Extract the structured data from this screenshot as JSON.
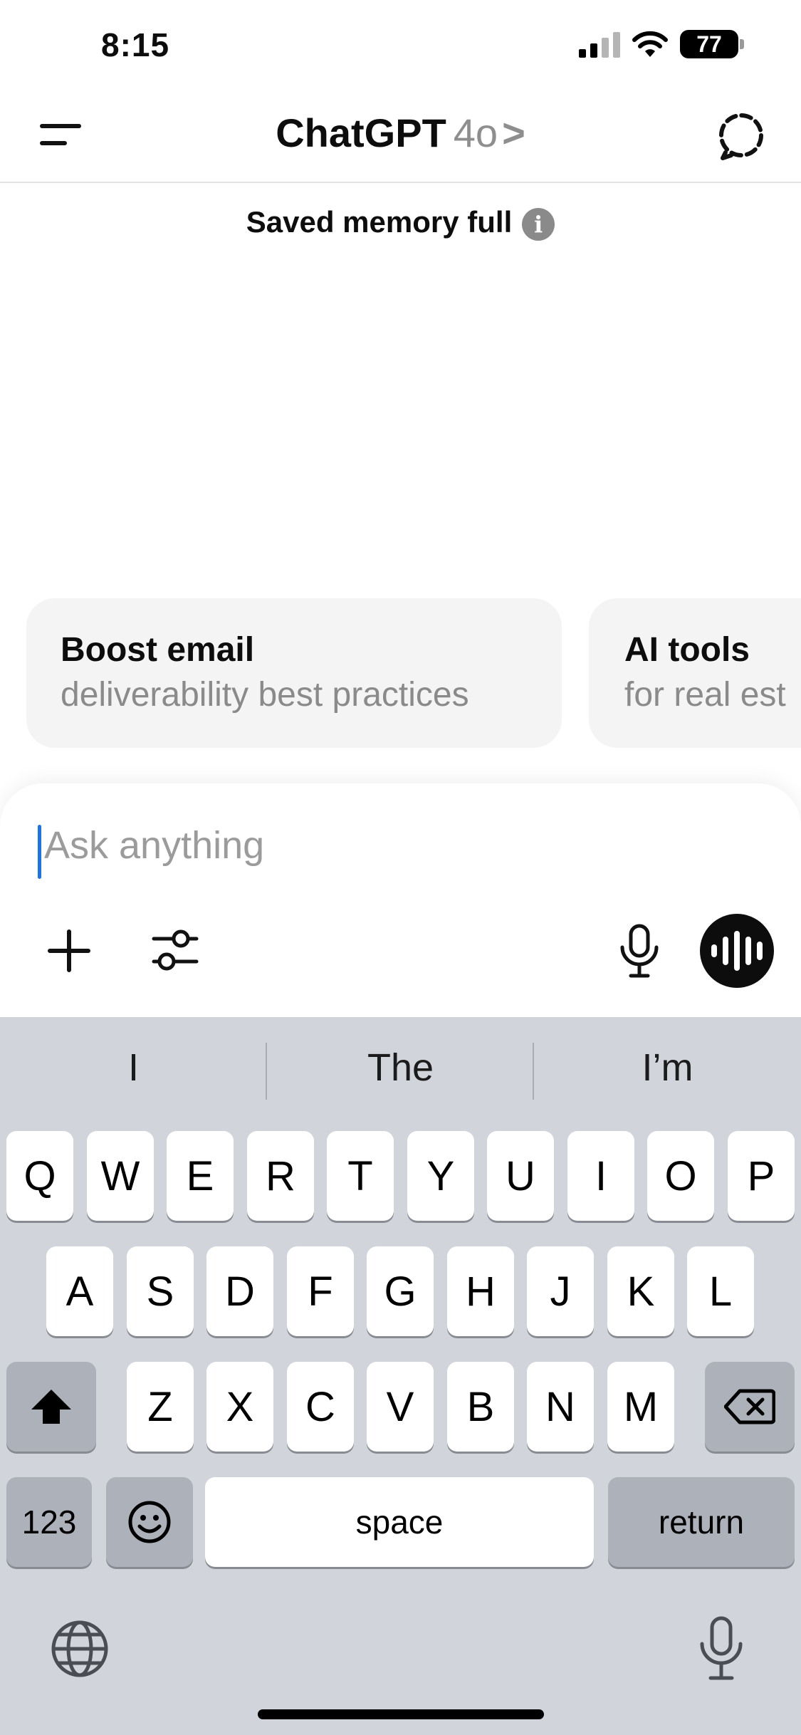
{
  "status_bar": {
    "time": "8:15",
    "battery": "77"
  },
  "header": {
    "title": "ChatGPT",
    "model": "4o",
    "chevron": ">"
  },
  "memory_notice": {
    "text": "Saved memory full",
    "info": "i"
  },
  "suggestions": [
    {
      "title": "Boost email",
      "subtitle": "deliverability best practices"
    },
    {
      "title": "AI tools",
      "subtitle": "for real est"
    }
  ],
  "composer": {
    "placeholder": "Ask anything",
    "value": ""
  },
  "keyboard": {
    "predictions": [
      "I",
      "The",
      "I’m"
    ],
    "row1": [
      "Q",
      "W",
      "E",
      "R",
      "T",
      "Y",
      "U",
      "I",
      "O",
      "P"
    ],
    "row2": [
      "A",
      "S",
      "D",
      "F",
      "G",
      "H",
      "J",
      "K",
      "L"
    ],
    "row3": [
      "Z",
      "X",
      "C",
      "V",
      "B",
      "N",
      "M"
    ],
    "numbers_key": "123",
    "space_key": "space",
    "return_key": "return"
  },
  "colors": {
    "caret": "#1a73e8",
    "keyboard_bg": "#d1d4db",
    "voice_button": "#0d0d0d"
  },
  "icons": [
    "menu-icon",
    "new-chat-icon",
    "info-icon",
    "plus-icon",
    "sliders-icon",
    "microphone-icon",
    "voice-wave-icon",
    "shift-icon",
    "backspace-icon",
    "emoji-icon",
    "globe-icon",
    "dictation-mic-icon"
  ]
}
